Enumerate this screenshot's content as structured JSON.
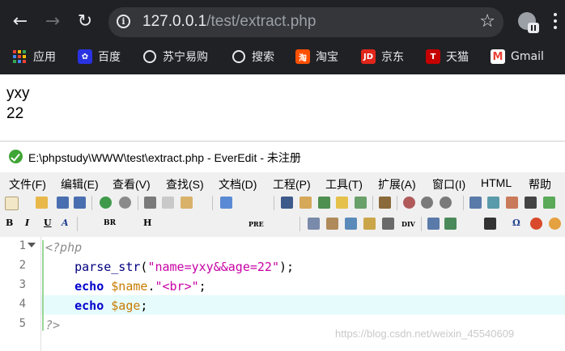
{
  "browser": {
    "url_host": "127.0.0.1",
    "url_path": "/test/extract.php",
    "bookmarks": [
      {
        "label": "应用",
        "icon": "apps-icon"
      },
      {
        "label": "百度",
        "icon": "baidu-icon",
        "color": "#2932e1"
      },
      {
        "label": "苏宁易购",
        "icon": "globe-icon"
      },
      {
        "label": "搜索",
        "icon": "globe-icon"
      },
      {
        "label": "淘宝",
        "icon": "taobao-icon",
        "color": "#ff5000"
      },
      {
        "label": "京东",
        "icon": "jd-icon",
        "color": "#e1251b"
      },
      {
        "label": "天猫",
        "icon": "tmall-icon",
        "color": "#c40000"
      },
      {
        "label": "Gmail",
        "icon": "gmail-icon",
        "color": "#ea4335"
      }
    ]
  },
  "page_output": {
    "lines": [
      "yxy",
      "22"
    ]
  },
  "editor": {
    "title": "E:\\phpstudy\\WWW\\test\\extract.php - EverEdit - 未注册",
    "menu": [
      "文件(F)",
      "编辑(E)",
      "查看(V)",
      "查找(S)",
      "文档(D)",
      "工程(P)",
      "工具(T)",
      "扩展(A)",
      "窗口(I)",
      "HTML",
      "帮助(H)"
    ],
    "toolbar_text": [
      "B",
      "I",
      "U",
      "A",
      "BR",
      "H",
      "PRE",
      "DIV"
    ],
    "line_numbers": [
      "1",
      "2",
      "3",
      "4",
      "5"
    ],
    "code": {
      "line1": "<?php",
      "line2_fn": "parse_str",
      "line2_open": "(",
      "line2_str": "\"name=yxy&&age=22\"",
      "line2_close": ");",
      "line3_kw": "echo",
      "line3_var": "$name",
      "line3_dot": ".",
      "line3_str": "\"<br>\"",
      "line3_end": ";",
      "line4_kw": "echo",
      "line4_var": "$age",
      "line4_end": ";",
      "line5": "?>"
    },
    "watermark": "https://blog.csdn.net/weixin_45540609"
  },
  "colors": {
    "browser_bg": "#202124",
    "php_tag": "#8c8c8c",
    "function": "#000080",
    "string": "#c800a4",
    "keyword": "#0000cc",
    "variable": "#c87a00",
    "current_line": "#e6fbfb"
  }
}
